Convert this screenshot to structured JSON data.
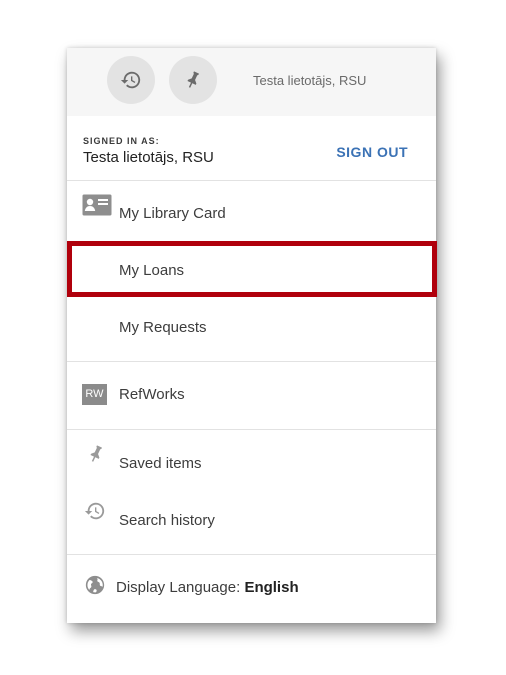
{
  "user_menu": {
    "header": {
      "history_icon": "history-icon",
      "pin_icon": "pin-icon",
      "username": "Testa lietotājs, RSU"
    },
    "signed_in": {
      "caption": "SIGNED IN AS:",
      "name": "Testa lietotājs, RSU",
      "sign_out_label": "SIGN OUT"
    },
    "items": [
      {
        "label": "My Library Card",
        "icon": "id-card-icon"
      },
      {
        "label": "My Loans",
        "icon": null,
        "highlighted": true
      },
      {
        "label": "My Requests",
        "icon": null
      },
      {
        "label": "RefWorks",
        "icon": "refworks-badge",
        "badge": "RW"
      },
      {
        "label": "Saved items",
        "icon": "pin-icon"
      },
      {
        "label": "Search history",
        "icon": "history-icon"
      }
    ],
    "language": {
      "prefix": "Display Language",
      "separator": ":",
      "value": "English",
      "icon": "globe-icon"
    }
  },
  "colors": {
    "accent": "#3b72b5",
    "highlight_border": "#b0000c",
    "topbar_bg": "#f6f6f6"
  }
}
